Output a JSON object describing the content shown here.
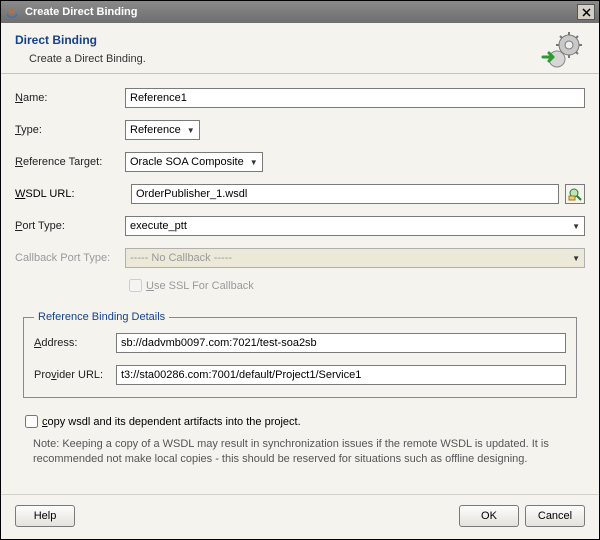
{
  "window": {
    "title": "Create Direct Binding"
  },
  "header": {
    "title": "Direct Binding",
    "desc": "Create a Direct Binding."
  },
  "labels": {
    "name": "Name:",
    "type": "Type:",
    "refTarget": "Reference Target:",
    "wsdlUrl": "WSDL URL:",
    "portType": "Port Type:",
    "callbackPortType": "Callback Port Type:",
    "useSsl": "Use SSL For Callback",
    "detailsLegend": "Reference Binding Details",
    "address": "Address:",
    "providerUrl": "Provider URL:",
    "copyWsdl": "copy wsdl and its dependent artifacts into the project.",
    "note": "Note: Keeping a copy of a WSDL may result in synchronization issues if the remote WSDL is updated. It is recommended not make local copies - this should be reserved for situations such as offline designing."
  },
  "values": {
    "name": "Reference1",
    "type": "Reference",
    "refTarget": "Oracle SOA Composite",
    "wsdlUrl": "OrderPublisher_1.wsdl",
    "portType": "execute_ptt",
    "callbackPortType": "----- No Callback -----",
    "address": "sb://dadvmb0097.com:7021/test-soa2sb",
    "providerUrl": "t3://sta00286.com:7001/default/Project1/Service1"
  },
  "buttons": {
    "help": "Help",
    "ok": "OK",
    "cancel": "Cancel"
  }
}
